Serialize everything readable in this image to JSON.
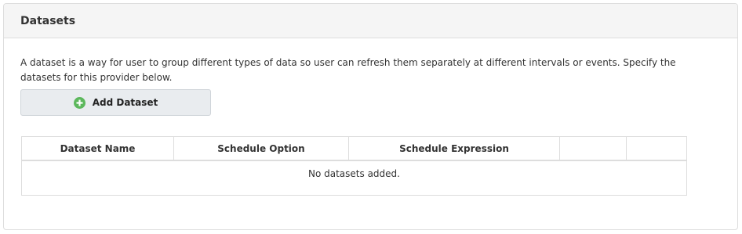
{
  "panel": {
    "title": "Datasets",
    "description": "A dataset is a way for user to group different types of data so user can refresh them separately at different intervals or events. Specify the datasets for this provider below.",
    "add_button_label": "Add Dataset",
    "add_button_icon": "plus-circle-icon",
    "accent_color": "#5cb85c"
  },
  "table": {
    "columns": [
      "Dataset Name",
      "Schedule Option",
      "Schedule Expression",
      "",
      ""
    ],
    "empty_message": "No datasets added."
  }
}
